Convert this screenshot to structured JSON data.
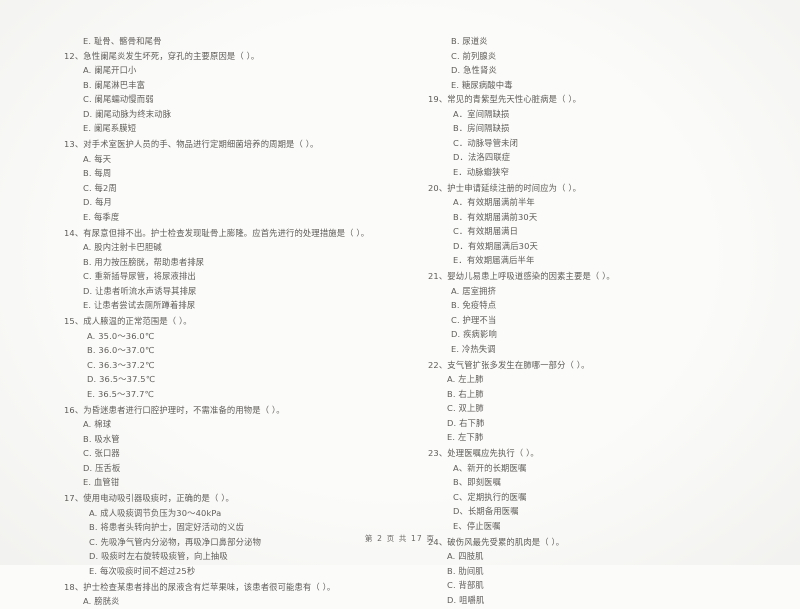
{
  "document": {
    "footer": "第 2 页  共 17 页",
    "page_number": "2",
    "total_pages": "17",
    "text_color": "#5d5b58",
    "background_color": "#fbfbf9"
  },
  "left_column": {
    "orphan_option": "E. 耻骨、髂骨和尾骨",
    "questions": [
      {
        "stem": "12、急性阑尾炎发生坏死，穿孔的主要原因是（      ）。",
        "options": [
          "A. 阑尾开口小",
          "B. 阑尾淋巴丰富",
          "C. 阑尾蠕动慢而弱",
          "D. 阑尾动脉为终末动脉",
          "E. 阑尾系膜短"
        ]
      },
      {
        "stem": "13、对手术室医护人员的手、物品进行定期细菌培养的周期是（      ）。",
        "options": [
          "A. 每天",
          "B. 每周",
          "C. 每2周",
          "D. 每月",
          "E. 每季度"
        ]
      },
      {
        "stem": "14、有尿意但排不出。护士检查发现耻骨上膨隆。应首先进行的处理措施是（      ）。",
        "options": [
          "A. 股内注射卡巴胆碱",
          "B. 用力按压膀胱，帮助患者排尿",
          "C. 重新插导尿管，将尿液排出",
          "D. 让患者听流水声诱导其排尿",
          "E. 让患者尝试去厕所蹲着排尿"
        ]
      },
      {
        "stem": "15、成人腋温的正常范围是（      ）。",
        "options": [
          "A. 35.0～36.0℃",
          "B. 36.0～37.0℃",
          "C. 36.3～37.2℃",
          "D. 36.5～37.5℃",
          "E. 36.5～37.7℃"
        ]
      },
      {
        "stem": "16、为昏迷患者进行口腔护理时，不需准备的用物是（      ）。",
        "options": [
          "A. 棉球",
          "B. 吸水管",
          "C. 张口器",
          "D. 压舌板",
          "E. 血管钳"
        ]
      },
      {
        "stem": "17、使用电动吸引器吸痰时，正确的是（      ）。",
        "options": [
          "A.  成人吸痰调节负压为30～40kPa",
          "B.  将患者头转向护士，固定好活动的义齿",
          "C.  先吸净气管内分泌物，再吸净口鼻部分泌物",
          "D.  吸痰时左右旋转吸痰管，向上抽吸",
          "E.  每次吸痰时间不超过25秒"
        ]
      },
      {
        "stem": "18、护士检查某患者排出的尿液含有烂苹果味，该患者很可能患有（      ）。",
        "options": [
          "A. 膀胱炎"
        ]
      }
    ]
  },
  "right_column": {
    "orphan_options": [
      "B. 尿道炎",
      "C. 前列腺炎",
      "D. 急性肾炎",
      "E. 糖尿病酸中毒"
    ],
    "questions": [
      {
        "stem": "19、常见的青紫型先天性心脏病是（      ）。",
        "options": [
          "A．室间隔缺损",
          "B．房间隔缺损",
          "C．动脉导管未闭",
          "D．法洛四联症",
          "E．动脉瓣狭窄"
        ]
      },
      {
        "stem": "20、护士申请延续注册的时间应为（      ）。",
        "options": [
          "A．有效期届满前半年",
          "B．有效期届满前30天",
          "C．有效期届满日",
          "D．有效期届满后30天",
          "E．有效期届满后半年"
        ]
      },
      {
        "stem": "21、婴幼儿易患上呼吸道感染的因素主要是（      ）。",
        "options": [
          "A. 居室拥挤",
          "B. 免疫特点",
          "C. 护理不当",
          "D. 疾病影响",
          "E. 冷热失调"
        ]
      },
      {
        "stem": "22、支气管扩张多发生在肺哪一部分（      ）。",
        "options": [
          "A. 左上肺",
          "B. 右上肺",
          "C. 双上肺",
          "D. 右下肺",
          "E. 左下肺"
        ]
      },
      {
        "stem": "23、处理医嘱应先执行（      ）。",
        "options": [
          "A、新开的长期医嘱",
          "B、即刻医嘱",
          "C、定期执行的医嘱",
          "D、长期备用医嘱",
          "E、停止医嘱"
        ]
      },
      {
        "stem": "24、破伤风最先受累的肌肉是（      ）。",
        "options": [
          "A. 四肢肌",
          "B. 肋间肌",
          "C. 背部肌",
          "D. 咀嚼肌"
        ]
      }
    ]
  }
}
